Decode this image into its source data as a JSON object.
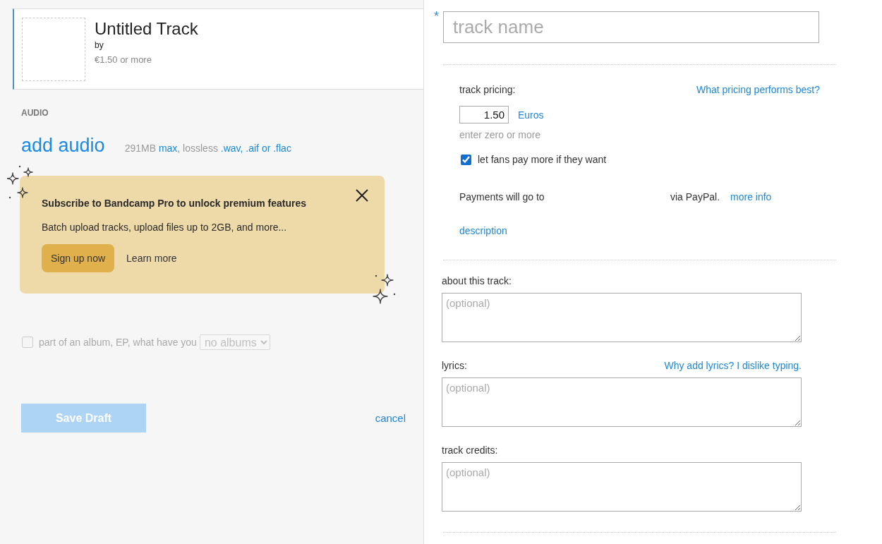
{
  "track_card": {
    "title": "Untitled Track",
    "by": "by",
    "price": "€1.50 or more"
  },
  "audio": {
    "heading": "AUDIO",
    "add_link": "add audio",
    "limits": [
      {
        "kind": "text",
        "text": "291MB "
      },
      {
        "kind": "link",
        "text": "max"
      },
      {
        "kind": "text",
        "text": ", lossless "
      },
      {
        "kind": "link",
        "text": ".wav, .aif or .flac"
      }
    ]
  },
  "promo": {
    "title": "Subscribe to Bandcamp Pro to unlock premium features",
    "body": "Batch upload tracks, upload files up to 2GB, and more...",
    "primary_button": "Sign up now",
    "secondary_link": "Learn more"
  },
  "album": {
    "checked": false,
    "disabled": true,
    "label": "part of an album, EP, what have you",
    "select_value": "no albums"
  },
  "actions": {
    "save_button": "Save Draft",
    "save_disabled": true,
    "cancel_link": "cancel"
  },
  "track_name": {
    "required_mark": "*",
    "placeholder": "track name"
  },
  "pricing": {
    "label": "track pricing:",
    "help_link": "What pricing performs best?",
    "price_value": "1.50",
    "currency": "Euros",
    "hint": "enter zero or more",
    "pay_more": {
      "checked": true,
      "label": "let fans pay more if they want"
    },
    "payments_prefix": "Payments will go to",
    "payments_suffix": "via PayPal.",
    "more_info_link": "more info",
    "description_link": "description"
  },
  "fields": [
    {
      "label": "about this track:",
      "placeholder": "(optional)"
    },
    {
      "label": "lyrics:",
      "help_link": "Why add lyrics? I dislike typing.",
      "placeholder": "(optional)"
    },
    {
      "label": "track credits:",
      "placeholder": "(optional)"
    }
  ]
}
